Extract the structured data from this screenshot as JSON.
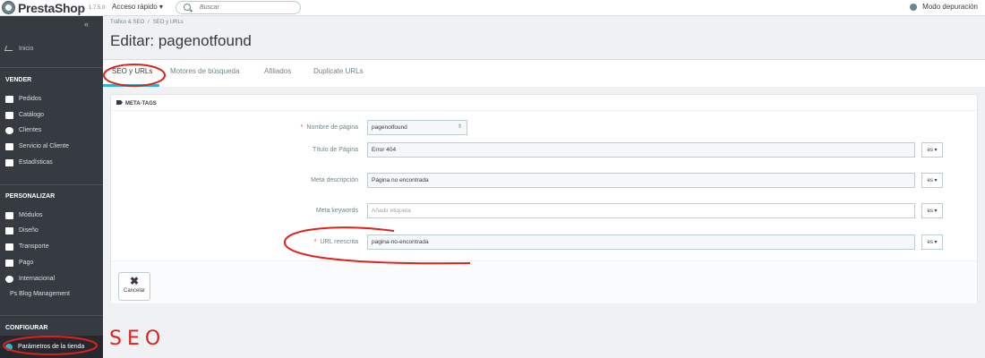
{
  "header": {
    "logo_text": "PrestaShop",
    "version": "1.7.5.0",
    "quick_access": "Acceso rápido ▾",
    "search_placeholder": "Buscar",
    "debug_mode": "Modo depuración"
  },
  "sidebar": {
    "collapse": "«",
    "inicio": "Inicio",
    "sections": [
      {
        "title": "VENDER",
        "items": [
          "Pedidos",
          "Catálogo",
          "Clientes",
          "Servicio al Cliente",
          "Estadísticas"
        ]
      },
      {
        "title": "PERSONALIZAR",
        "items": [
          "Módulos",
          "Diseño",
          "Transporte",
          "Pago",
          "Internacional",
          "Ps Blog Management"
        ]
      },
      {
        "title": "CONFIGURAR",
        "items": [
          "Parámetros de la tienda"
        ]
      }
    ]
  },
  "breadcrumb": [
    "Tráfico & SEO",
    "SEO y URLs"
  ],
  "page_title": "Editar: pagenotfound",
  "tabs": [
    "SEO y URLs",
    "Motores de búsqueda",
    "Afiliados",
    "Duplicate URLs"
  ],
  "panel": {
    "heading": "META-TAGS",
    "fields": [
      {
        "label": "Nombre de página",
        "required": true,
        "value": "pagenotfound",
        "type": "select"
      },
      {
        "label": "Título de Página",
        "required": false,
        "value": "Error 404",
        "lang": "es ▾"
      },
      {
        "label": "Meta descripción",
        "required": false,
        "value": "Página no encontrada",
        "lang": "es ▾"
      },
      {
        "label": "Meta keywords",
        "required": false,
        "placeholder": "Añadir etiqueta",
        "lang": "es ▾"
      },
      {
        "label": "URL reescrita",
        "required": true,
        "value": "pagina-no-encontrada",
        "lang": "es ▾"
      }
    ],
    "required_mark": "*",
    "cancel_icon": "✖",
    "cancel_label": "Cancelar"
  },
  "annotation_text": "SEO",
  "colors": {
    "sidebar_bg": "#363a41",
    "accent": "#25b9d7",
    "annotation_red": "#e0201a"
  }
}
